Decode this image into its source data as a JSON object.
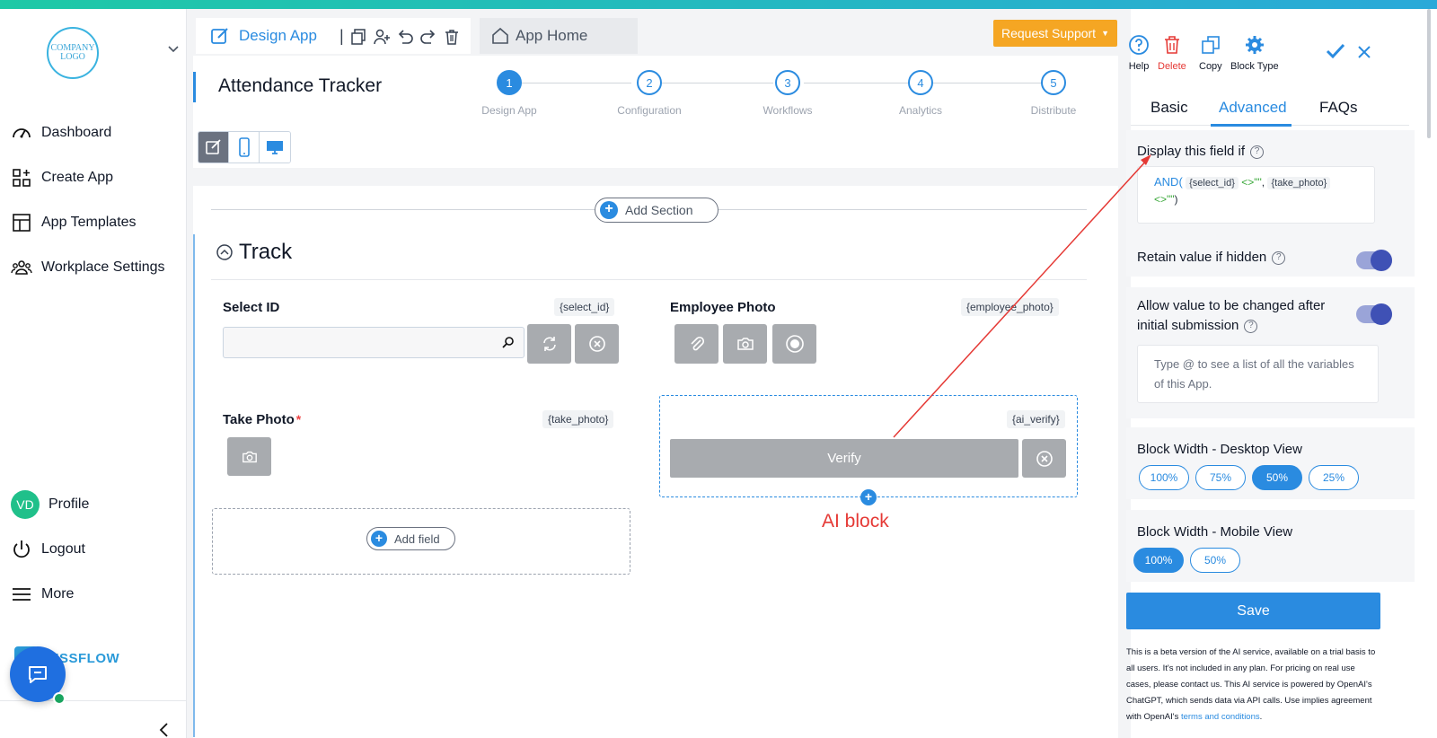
{
  "logo": {
    "text": "COMPANY LOGO"
  },
  "sidebar": {
    "items": [
      {
        "label": "Dashboard",
        "icon": "gauge-icon"
      },
      {
        "label": "Create App",
        "icon": "grid-plus-icon"
      },
      {
        "label": "App Templates",
        "icon": "template-icon"
      },
      {
        "label": "Workplace Settings",
        "icon": "users-icon"
      }
    ],
    "profile": {
      "initials": "VD",
      "label": "Profile"
    },
    "logout": "Logout",
    "more": "More",
    "brand": "KISSFLOW"
  },
  "header": {
    "design_tab": "Design App",
    "home_tab": "App Home",
    "request_support": "Request Support"
  },
  "app": {
    "title": "Attendance Tracker",
    "steps": [
      {
        "num": "1",
        "label": "Design App",
        "active": true
      },
      {
        "num": "2",
        "label": "Configuration",
        "active": false
      },
      {
        "num": "3",
        "label": "Workflows",
        "active": false
      },
      {
        "num": "4",
        "label": "Analytics",
        "active": false
      },
      {
        "num": "5",
        "label": "Distribute",
        "active": false
      }
    ]
  },
  "canvas": {
    "add_section": "Add Section",
    "section_title": "Track",
    "fields": {
      "select_id": {
        "label": "Select ID",
        "var": "{select_id}"
      },
      "employee_photo": {
        "label": "Employee Photo",
        "var": "{employee_photo}"
      },
      "take_photo": {
        "label": "Take Photo",
        "var": "{take_photo}",
        "required": "*"
      },
      "ai_verify": {
        "var": "{ai_verify}",
        "button": "Verify"
      }
    },
    "add_field": "Add field",
    "annotation": "AI block"
  },
  "panel": {
    "tools": [
      "Help",
      "Delete",
      "Copy",
      "Block Type"
    ],
    "tabs": [
      "Basic",
      "Advanced",
      "FAQs"
    ],
    "active_tab": "Advanced",
    "display_if": {
      "label": "Display this field if",
      "formula_fn": "AND(",
      "token1": "{select_id}",
      "op": "<>\"\"",
      "comma": ",",
      "token2": "{take_photo}",
      "op2": "<>\"\"",
      "close": ")"
    },
    "retain": "Retain value if hidden",
    "allow_change_line1": "Allow value to be changed after",
    "allow_change_line2": "initial submission",
    "var_placeholder": "Type @ to see a list of all the variables of this App.",
    "desktop_width": {
      "label": "Block Width - Desktop View",
      "options": [
        "100%",
        "75%",
        "50%",
        "25%"
      ],
      "selected": "50%"
    },
    "mobile_width": {
      "label": "Block Width - Mobile View",
      "options": [
        "100%",
        "50%"
      ],
      "selected": "100%"
    },
    "save": "Save",
    "disclaimer": "This is a beta version of the AI service, available on a trial basis to all users. It's not included in any plan. For pricing on real use cases, please contact us. This AI service is powered by OpenAI's ChatGPT, which sends data via API calls. Use implies agreement with OpenAI's",
    "disclaimer_link": "terms and conditions",
    "disclaimer_end": "."
  },
  "colors": {
    "accent": "#2a8be0",
    "warning": "#f5a623",
    "annotation": "#e53935"
  }
}
